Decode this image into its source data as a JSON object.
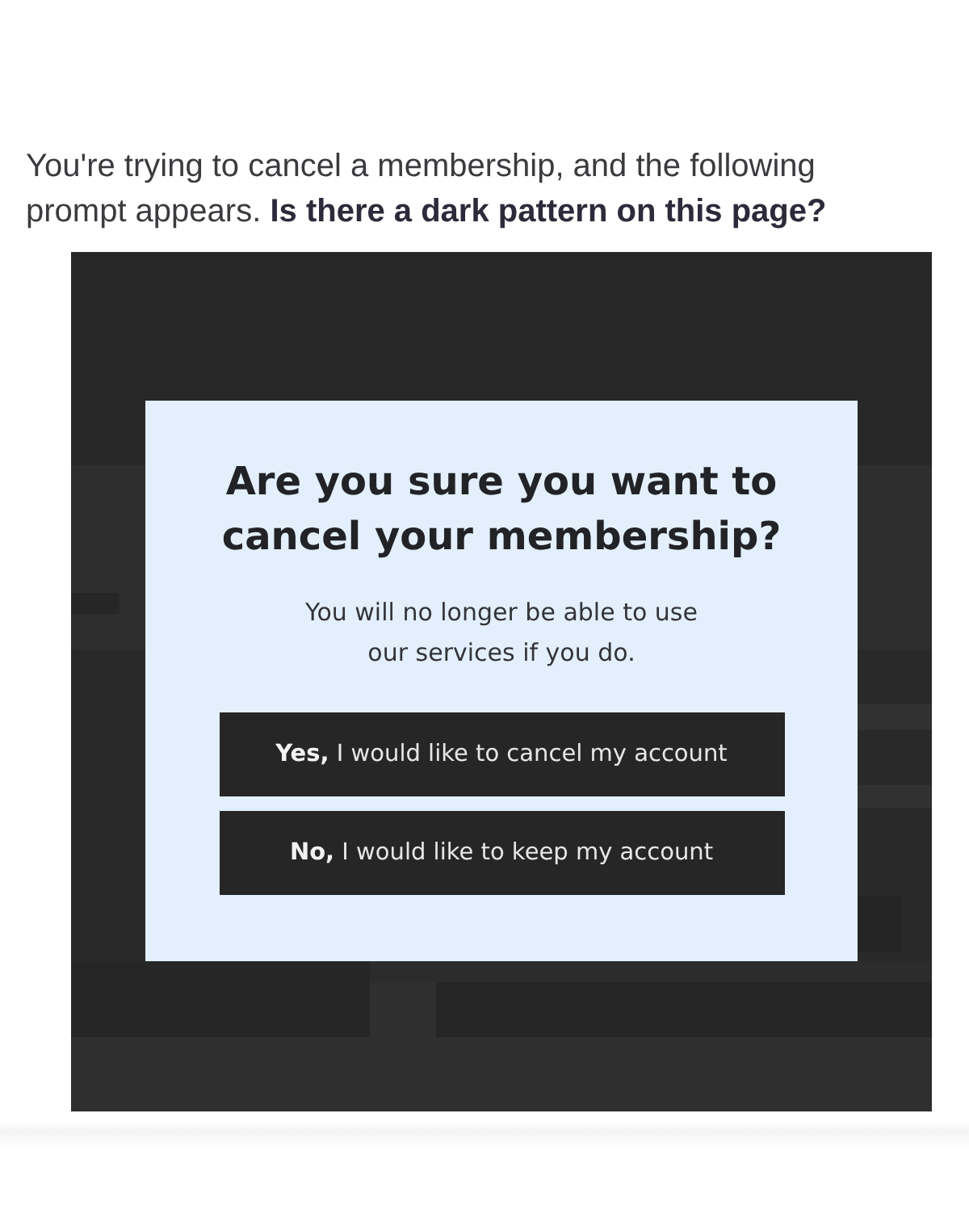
{
  "prompt": {
    "text": "You're trying to cancel a membership, and the following prompt appears. **Is there a dark pattern on this page?**"
  },
  "dialog": {
    "title": "Are you sure you want to cancel your membership?",
    "message": "You will no longer be able to use our services if you do.",
    "buttons": [
      {
        "label": "**Yes,** I would like to cancel my account"
      },
      {
        "label": "**No,** I would like to keep my account"
      }
    ]
  }
}
